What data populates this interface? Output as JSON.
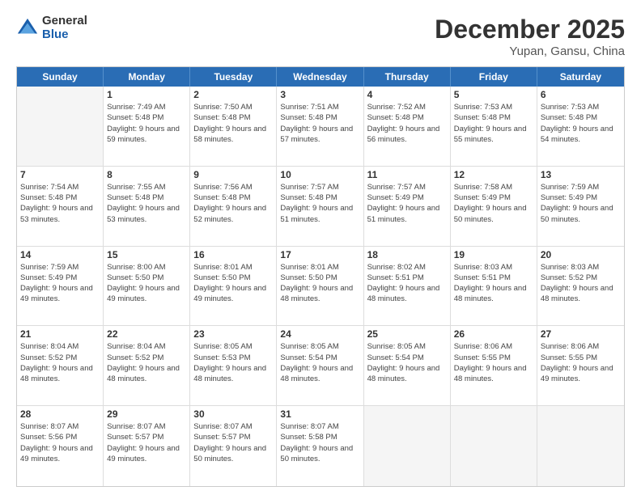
{
  "logo": {
    "general": "General",
    "blue": "Blue"
  },
  "title": {
    "month": "December 2025",
    "location": "Yupan, Gansu, China"
  },
  "header_days": [
    "Sunday",
    "Monday",
    "Tuesday",
    "Wednesday",
    "Thursday",
    "Friday",
    "Saturday"
  ],
  "weeks": [
    [
      {
        "day": "",
        "empty": true
      },
      {
        "day": "1",
        "sunrise": "Sunrise: 7:49 AM",
        "sunset": "Sunset: 5:48 PM",
        "daylight": "Daylight: 9 hours and 59 minutes."
      },
      {
        "day": "2",
        "sunrise": "Sunrise: 7:50 AM",
        "sunset": "Sunset: 5:48 PM",
        "daylight": "Daylight: 9 hours and 58 minutes."
      },
      {
        "day": "3",
        "sunrise": "Sunrise: 7:51 AM",
        "sunset": "Sunset: 5:48 PM",
        "daylight": "Daylight: 9 hours and 57 minutes."
      },
      {
        "day": "4",
        "sunrise": "Sunrise: 7:52 AM",
        "sunset": "Sunset: 5:48 PM",
        "daylight": "Daylight: 9 hours and 56 minutes."
      },
      {
        "day": "5",
        "sunrise": "Sunrise: 7:53 AM",
        "sunset": "Sunset: 5:48 PM",
        "daylight": "Daylight: 9 hours and 55 minutes."
      },
      {
        "day": "6",
        "sunrise": "Sunrise: 7:53 AM",
        "sunset": "Sunset: 5:48 PM",
        "daylight": "Daylight: 9 hours and 54 minutes."
      }
    ],
    [
      {
        "day": "7",
        "sunrise": "Sunrise: 7:54 AM",
        "sunset": "Sunset: 5:48 PM",
        "daylight": "Daylight: 9 hours and 53 minutes."
      },
      {
        "day": "8",
        "sunrise": "Sunrise: 7:55 AM",
        "sunset": "Sunset: 5:48 PM",
        "daylight": "Daylight: 9 hours and 53 minutes."
      },
      {
        "day": "9",
        "sunrise": "Sunrise: 7:56 AM",
        "sunset": "Sunset: 5:48 PM",
        "daylight": "Daylight: 9 hours and 52 minutes."
      },
      {
        "day": "10",
        "sunrise": "Sunrise: 7:57 AM",
        "sunset": "Sunset: 5:48 PM",
        "daylight": "Daylight: 9 hours and 51 minutes."
      },
      {
        "day": "11",
        "sunrise": "Sunrise: 7:57 AM",
        "sunset": "Sunset: 5:49 PM",
        "daylight": "Daylight: 9 hours and 51 minutes."
      },
      {
        "day": "12",
        "sunrise": "Sunrise: 7:58 AM",
        "sunset": "Sunset: 5:49 PM",
        "daylight": "Daylight: 9 hours and 50 minutes."
      },
      {
        "day": "13",
        "sunrise": "Sunrise: 7:59 AM",
        "sunset": "Sunset: 5:49 PM",
        "daylight": "Daylight: 9 hours and 50 minutes."
      }
    ],
    [
      {
        "day": "14",
        "sunrise": "Sunrise: 7:59 AM",
        "sunset": "Sunset: 5:49 PM",
        "daylight": "Daylight: 9 hours and 49 minutes."
      },
      {
        "day": "15",
        "sunrise": "Sunrise: 8:00 AM",
        "sunset": "Sunset: 5:50 PM",
        "daylight": "Daylight: 9 hours and 49 minutes."
      },
      {
        "day": "16",
        "sunrise": "Sunrise: 8:01 AM",
        "sunset": "Sunset: 5:50 PM",
        "daylight": "Daylight: 9 hours and 49 minutes."
      },
      {
        "day": "17",
        "sunrise": "Sunrise: 8:01 AM",
        "sunset": "Sunset: 5:50 PM",
        "daylight": "Daylight: 9 hours and 48 minutes."
      },
      {
        "day": "18",
        "sunrise": "Sunrise: 8:02 AM",
        "sunset": "Sunset: 5:51 PM",
        "daylight": "Daylight: 9 hours and 48 minutes."
      },
      {
        "day": "19",
        "sunrise": "Sunrise: 8:03 AM",
        "sunset": "Sunset: 5:51 PM",
        "daylight": "Daylight: 9 hours and 48 minutes."
      },
      {
        "day": "20",
        "sunrise": "Sunrise: 8:03 AM",
        "sunset": "Sunset: 5:52 PM",
        "daylight": "Daylight: 9 hours and 48 minutes."
      }
    ],
    [
      {
        "day": "21",
        "sunrise": "Sunrise: 8:04 AM",
        "sunset": "Sunset: 5:52 PM",
        "daylight": "Daylight: 9 hours and 48 minutes."
      },
      {
        "day": "22",
        "sunrise": "Sunrise: 8:04 AM",
        "sunset": "Sunset: 5:52 PM",
        "daylight": "Daylight: 9 hours and 48 minutes."
      },
      {
        "day": "23",
        "sunrise": "Sunrise: 8:05 AM",
        "sunset": "Sunset: 5:53 PM",
        "daylight": "Daylight: 9 hours and 48 minutes."
      },
      {
        "day": "24",
        "sunrise": "Sunrise: 8:05 AM",
        "sunset": "Sunset: 5:54 PM",
        "daylight": "Daylight: 9 hours and 48 minutes."
      },
      {
        "day": "25",
        "sunrise": "Sunrise: 8:05 AM",
        "sunset": "Sunset: 5:54 PM",
        "daylight": "Daylight: 9 hours and 48 minutes."
      },
      {
        "day": "26",
        "sunrise": "Sunrise: 8:06 AM",
        "sunset": "Sunset: 5:55 PM",
        "daylight": "Daylight: 9 hours and 48 minutes."
      },
      {
        "day": "27",
        "sunrise": "Sunrise: 8:06 AM",
        "sunset": "Sunset: 5:55 PM",
        "daylight": "Daylight: 9 hours and 49 minutes."
      }
    ],
    [
      {
        "day": "28",
        "sunrise": "Sunrise: 8:07 AM",
        "sunset": "Sunset: 5:56 PM",
        "daylight": "Daylight: 9 hours and 49 minutes."
      },
      {
        "day": "29",
        "sunrise": "Sunrise: 8:07 AM",
        "sunset": "Sunset: 5:57 PM",
        "daylight": "Daylight: 9 hours and 49 minutes."
      },
      {
        "day": "30",
        "sunrise": "Sunrise: 8:07 AM",
        "sunset": "Sunset: 5:57 PM",
        "daylight": "Daylight: 9 hours and 50 minutes."
      },
      {
        "day": "31",
        "sunrise": "Sunrise: 8:07 AM",
        "sunset": "Sunset: 5:58 PM",
        "daylight": "Daylight: 9 hours and 50 minutes."
      },
      {
        "day": "",
        "empty": true
      },
      {
        "day": "",
        "empty": true
      },
      {
        "day": "",
        "empty": true
      }
    ]
  ]
}
